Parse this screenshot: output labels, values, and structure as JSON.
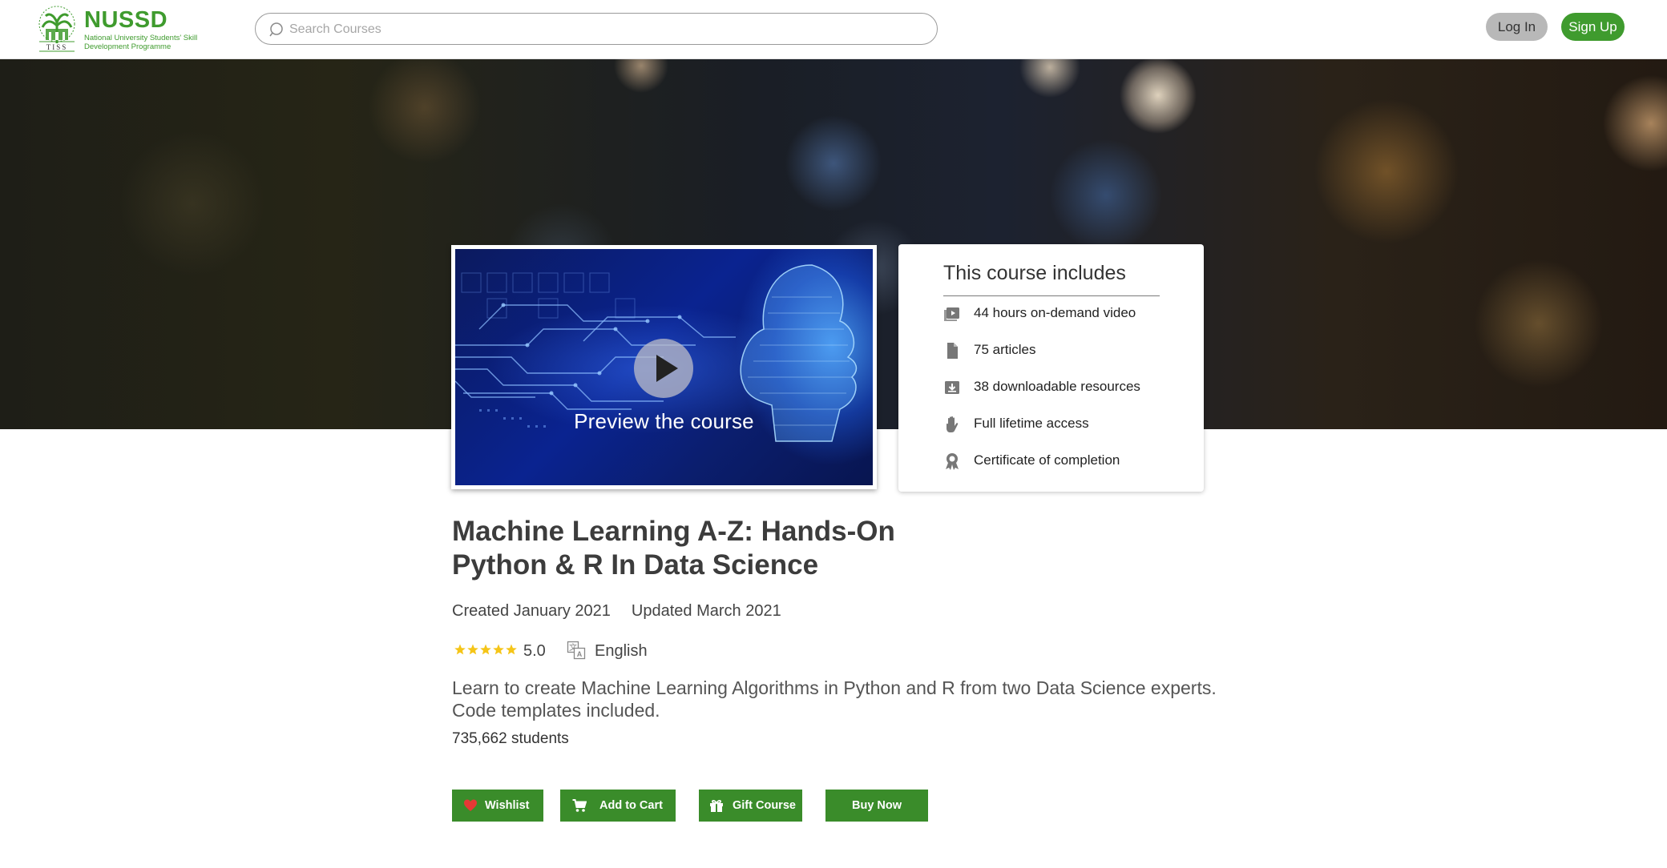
{
  "brand": {
    "name": "NUSSD",
    "tagline": "National University Students' Skill Development Programme",
    "emblem_text": "TISS",
    "color": "#3f9b2e"
  },
  "header": {
    "search_placeholder": "Search Courses",
    "login_label": "Log In",
    "signup_label": "Sign Up"
  },
  "preview": {
    "label": "Preview the course",
    "icon": "play-icon"
  },
  "includes": {
    "title": "This course includes",
    "items": [
      {
        "icon": "video-icon",
        "text": "44 hours on-demand video"
      },
      {
        "icon": "file-icon",
        "text": "75 articles"
      },
      {
        "icon": "download-icon",
        "text": "38 downloadable resources"
      },
      {
        "icon": "hand-icon",
        "text": "Full lifetime access"
      },
      {
        "icon": "certificate-icon",
        "text": "Certificate of completion"
      }
    ]
  },
  "course": {
    "title": "Machine Learning A-Z: Hands-On Python & R In Data Science",
    "created": "Created January 2021",
    "updated": "Updated March 2021",
    "rating": "5.0",
    "rating_value": 5,
    "language": "English",
    "description": "Learn to create Machine Learning Algorithms in Python and R from two Data Science experts. Code templates included.",
    "students": "735,662 students"
  },
  "actions": {
    "wishlist": "Wishlist",
    "add_to_cart": "Add to Cart",
    "gift": "Gift Course",
    "buy_now": "Buy Now"
  },
  "colors": {
    "accent": "#3f9b2e",
    "button": "#3a8c2a",
    "login_bg": "#b8b8b8",
    "star": "#f5c518",
    "heart": "#e53935"
  }
}
